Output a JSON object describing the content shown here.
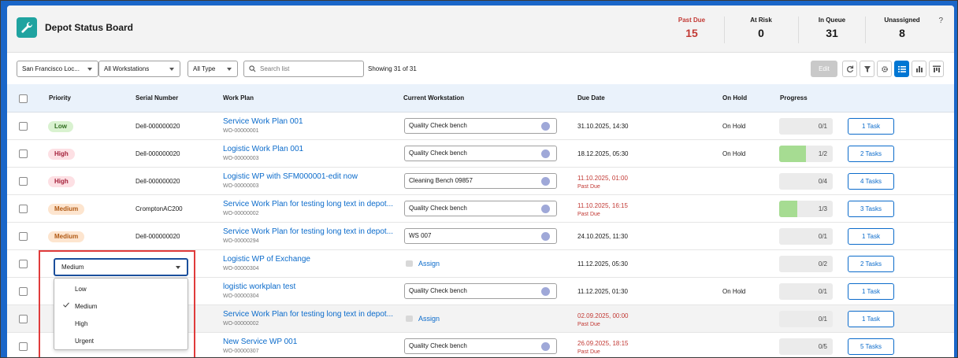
{
  "app": {
    "title": "Depot Status Board",
    "help": "?"
  },
  "stats": [
    {
      "label": "Past Due",
      "value": "15"
    },
    {
      "label": "At Risk",
      "value": "0"
    },
    {
      "label": "In Queue",
      "value": "31"
    },
    {
      "label": "Unassigned",
      "value": "8"
    }
  ],
  "toolbar": {
    "location": "San Francisco Loc...",
    "workstations": "All Workstations",
    "type": "All Type",
    "search_placeholder": "Search list",
    "showing": "Showing 31 of 31",
    "edit": "Edit"
  },
  "columns": [
    "Priority",
    "Serial Number",
    "Work Plan",
    "Current Workstation",
    "Due Date",
    "On Hold",
    "Progress"
  ],
  "rows": [
    {
      "priority": "Low",
      "serial": "Dell-000000020",
      "wp": "Service Work Plan 001",
      "wo": "WO-00000001",
      "ws": "Quality Check bench",
      "due": "31.10.2025, 14:30",
      "due_sub": "",
      "hold": "On Hold",
      "progress": "0/1",
      "progress_frac": 0,
      "tasks": "1 Task"
    },
    {
      "priority": "High",
      "serial": "Dell-000000020",
      "wp": "Logistic Work Plan 001",
      "wo": "WO-00000003",
      "ws": "Quality Check bench",
      "due": "18.12.2025, 05:30",
      "due_sub": "",
      "hold": "On Hold",
      "progress": "1/2",
      "progress_frac": 0.5,
      "tasks": "2 Tasks"
    },
    {
      "priority": "High",
      "serial": "Dell-000000020",
      "wp": "Logistic WP with SFM000001-edit now",
      "wo": "WO-00000003",
      "ws": "Cleaning Bench 09857",
      "due": "11.10.2025, 01:00",
      "due_sub": "Past Due",
      "hold": "",
      "progress": "0/4",
      "progress_frac": 0,
      "tasks": "4 Tasks"
    },
    {
      "priority": "Medium",
      "serial": "CromptonAC200",
      "wp": "Service Work Plan for testing long text in depot...",
      "wo": "WO-00000002",
      "ws": "Quality Check bench",
      "due": "11.10.2025, 16:15",
      "due_sub": "Past Due",
      "hold": "",
      "progress": "1/3",
      "progress_frac": 0.3333,
      "tasks": "3 Tasks"
    },
    {
      "priority": "Medium",
      "serial": "Dell-000000020",
      "wp": "Service Work Plan for testing long text in depot...",
      "wo": "WO-00000294",
      "ws": "WS 007",
      "due": "24.10.2025, 11:30",
      "due_sub": "",
      "hold": "",
      "progress": "0/1",
      "progress_frac": 0,
      "tasks": "1 Task"
    },
    {
      "priority": "",
      "serial": "",
      "wp": "Logistic WP of Exchange",
      "wo": "WO-00000304",
      "ws": "",
      "assign": "Assign",
      "due": "11.12.2025, 05:30",
      "due_sub": "",
      "hold": "",
      "progress": "0/2",
      "progress_frac": 0,
      "tasks": "2 Tasks"
    },
    {
      "priority": "",
      "serial": "",
      "wp": "logistic workplan test",
      "wo": "WO-00000304",
      "ws": "Quality Check bench",
      "due": "11.12.2025, 01:30",
      "due_sub": "",
      "hold": "On Hold",
      "progress": "0/1",
      "progress_frac": 0,
      "tasks": "1 Task"
    },
    {
      "priority": "",
      "serial": "",
      "wp": "Service Work Plan for testing long text in depot...",
      "wo": "WO-00000002",
      "ws": "",
      "assign": "Assign",
      "due": "02.09.2025, 00:00",
      "due_sub": "Past Due",
      "hold": "",
      "progress": "0/1",
      "progress_frac": 0,
      "tasks": "1 Task"
    },
    {
      "priority": "",
      "serial": "",
      "wp": "New Service WP 001",
      "wo": "WO-00000307",
      "ws": "Quality Check bench",
      "due": "26.09.2025, 18:15",
      "due_sub": "Past Due",
      "hold": "",
      "progress": "0/5",
      "progress_frac": 0,
      "tasks": "5 Tasks"
    }
  ],
  "priority_editor": {
    "selected": "Medium",
    "options": [
      "Low",
      "Medium",
      "High",
      "Urgent"
    ]
  },
  "colors": {
    "brand": "#1a66c8",
    "accent": "#0b6bcb",
    "danger": "#c23934",
    "app_icon": "#1fa3a0"
  }
}
